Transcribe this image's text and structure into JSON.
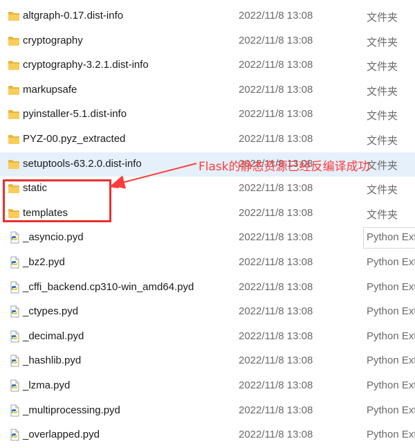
{
  "files": [
    {
      "name": "altgraph-0.17.dist-info",
      "date": "2022/11/8 13:08",
      "type": "文件夹",
      "icon": "folder-icon"
    },
    {
      "name": "cryptography",
      "date": "2022/11/8 13:08",
      "type": "文件夹",
      "icon": "folder-icon"
    },
    {
      "name": "cryptography-3.2.1.dist-info",
      "date": "2022/11/8 13:08",
      "type": "文件夹",
      "icon": "folder-icon"
    },
    {
      "name": "markupsafe",
      "date": "2022/11/8 13:08",
      "type": "文件夹",
      "icon": "folder-icon"
    },
    {
      "name": "pyinstaller-5.1.dist-info",
      "date": "2022/11/8 13:08",
      "type": "文件夹",
      "icon": "folder-icon"
    },
    {
      "name": "PYZ-00.pyz_extracted",
      "date": "2022/11/8 13:08",
      "type": "文件夹",
      "icon": "folder-icon"
    },
    {
      "name": "setuptools-63.2.0.dist-info",
      "date": "2022/11/8 13:08",
      "type": "文件夹",
      "icon": "folder-icon"
    },
    {
      "name": "static",
      "date": "2022/11/8 13:08",
      "type": "文件夹",
      "icon": "folder-icon"
    },
    {
      "name": "templates",
      "date": "2022/11/8 13:08",
      "type": "文件夹",
      "icon": "folder-icon"
    },
    {
      "name": "_asyncio.pyd",
      "date": "2022/11/8 13:08",
      "type": "Python Ext",
      "icon": "python-file-icon"
    },
    {
      "name": "_bz2.pyd",
      "date": "2022/11/8 13:08",
      "type": "Python Ext",
      "icon": "python-file-icon"
    },
    {
      "name": "_cffi_backend.cp310-win_amd64.pyd",
      "date": "2022/11/8 13:08",
      "type": "Python Ext",
      "icon": "python-file-icon"
    },
    {
      "name": "_ctypes.pyd",
      "date": "2022/11/8 13:08",
      "type": "Python Ext",
      "icon": "python-file-icon"
    },
    {
      "name": "_decimal.pyd",
      "date": "2022/11/8 13:08",
      "type": "Python Ext",
      "icon": "python-file-icon"
    },
    {
      "name": "_hashlib.pyd",
      "date": "2022/11/8 13:08",
      "type": "Python Ext",
      "icon": "python-file-icon"
    },
    {
      "name": "_lzma.pyd",
      "date": "2022/11/8 13:08",
      "type": "Python Ext",
      "icon": "python-file-icon"
    },
    {
      "name": "_multiprocessing.pyd",
      "date": "2022/11/8 13:08",
      "type": "Python Ext",
      "icon": "python-file-icon"
    },
    {
      "name": "_overlapped.pyd",
      "date": "2022/11/8 13:08",
      "type": "Python Ext",
      "icon": "python-file-icon"
    }
  ],
  "selected_index": 6,
  "type_tooltip_index": 9,
  "annotation": {
    "text": "Flask的静态资源已经反编译成功",
    "color": "#ff3b3b"
  },
  "colors": {
    "selected_row": "#e5f0fb",
    "highlight_box": "#ea2e2e",
    "folder": "#f8c64b"
  }
}
